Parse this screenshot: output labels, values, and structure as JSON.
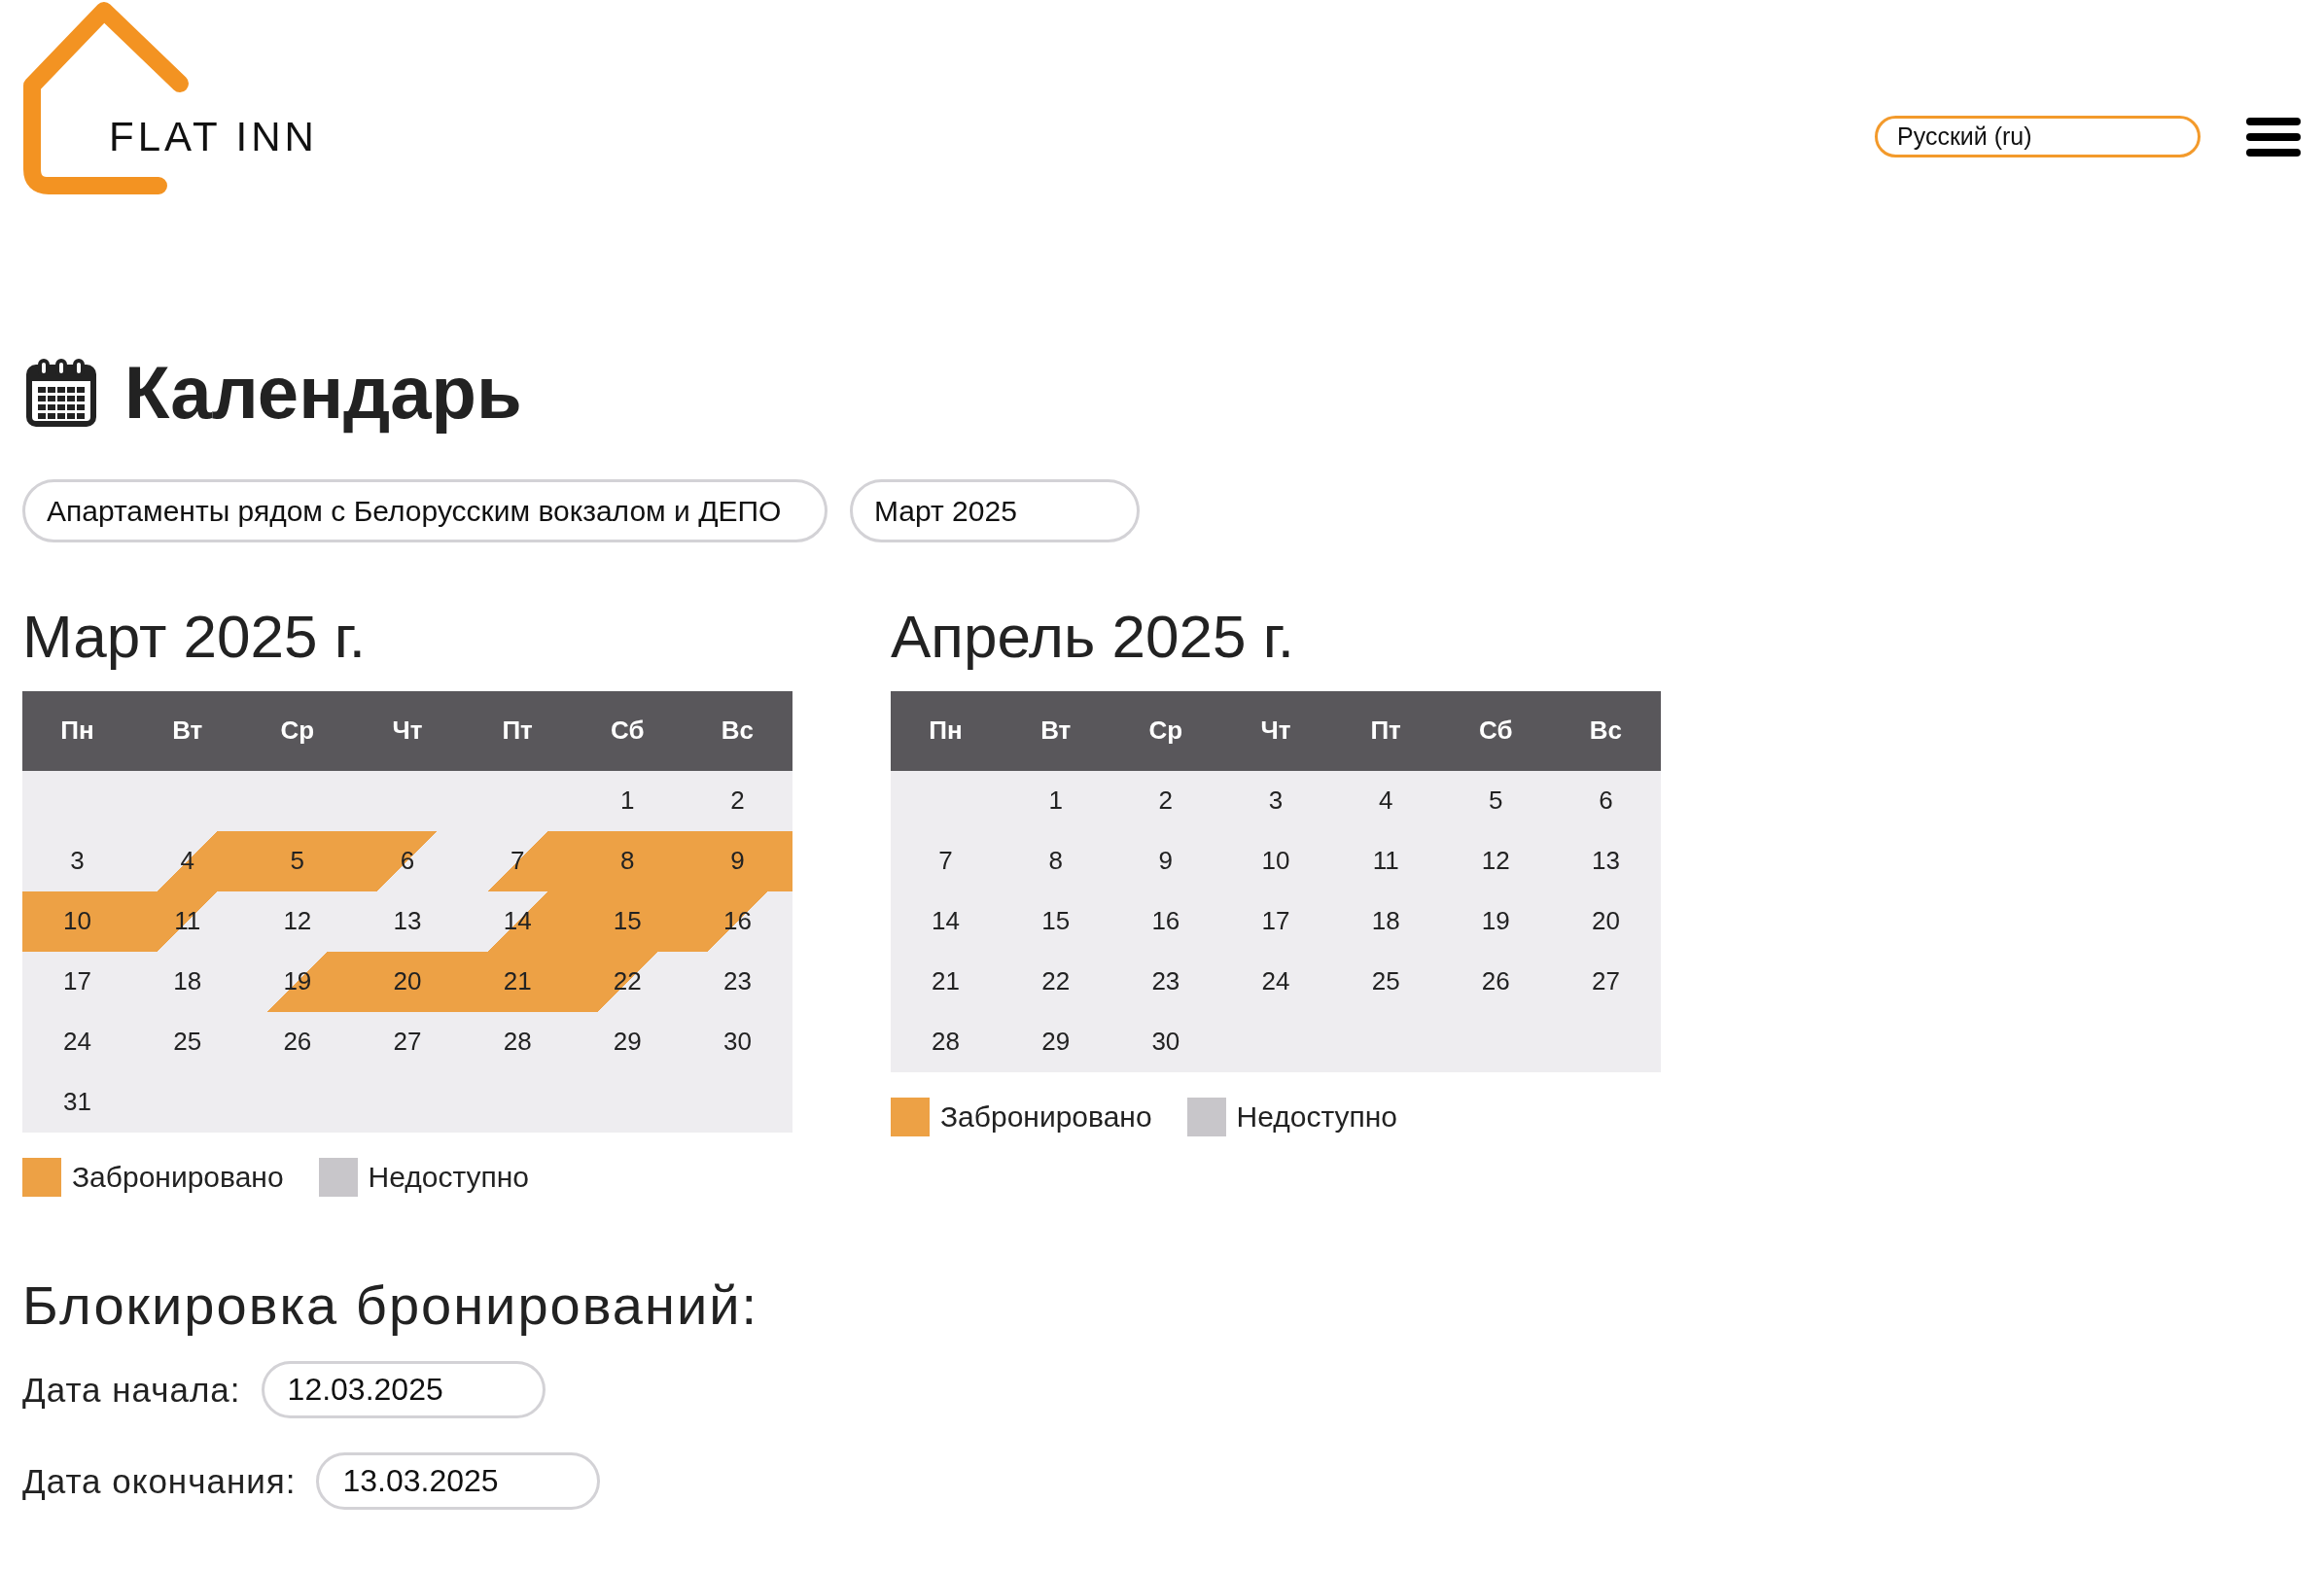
{
  "header": {
    "logo_text": "FLAT INN",
    "language": "Русский (ru)"
  },
  "page_title": "Календарь",
  "filters": [
    {
      "value": "Апартаменты рядом с Белорусским вокзалом и ДЕПО"
    },
    {
      "value": "Март 2025"
    }
  ],
  "months": [
    {
      "title": "Март 2025 г.",
      "weekdays": [
        "Пн",
        "Вт",
        "Ср",
        "Чт",
        "Пт",
        "Сб",
        "Вс"
      ],
      "weeks": [
        [
          {
            "day": "1",
            "kind": "free"
          },
          {
            "day": "2",
            "kind": "free"
          }
        ],
        [
          {
            "day": "3",
            "kind": "free"
          },
          {
            "day": "4",
            "kind": "checkin"
          },
          {
            "day": "5",
            "kind": "booked"
          },
          {
            "day": "6",
            "kind": "checkout"
          },
          {
            "day": "7",
            "kind": "checkin"
          },
          {
            "day": "8",
            "kind": "booked"
          },
          {
            "day": "9",
            "kind": "booked"
          }
        ],
        [
          {
            "day": "10",
            "kind": "booked"
          },
          {
            "day": "11",
            "kind": "checkout"
          },
          {
            "day": "12",
            "kind": "free"
          },
          {
            "day": "13",
            "kind": "free"
          },
          {
            "day": "14",
            "kind": "checkin"
          },
          {
            "day": "15",
            "kind": "booked"
          },
          {
            "day": "16",
            "kind": "checkout"
          }
        ],
        [
          {
            "day": "17",
            "kind": "free"
          },
          {
            "day": "18",
            "kind": "free"
          },
          {
            "day": "19",
            "kind": "checkin"
          },
          {
            "day": "20",
            "kind": "booked"
          },
          {
            "day": "21",
            "kind": "booked"
          },
          {
            "day": "22",
            "kind": "checkout"
          },
          {
            "day": "23",
            "kind": "free"
          }
        ],
        [
          {
            "day": "24",
            "kind": "free"
          },
          {
            "day": "25",
            "kind": "free"
          },
          {
            "day": "26",
            "kind": "free"
          },
          {
            "day": "27",
            "kind": "free"
          },
          {
            "day": "28",
            "kind": "free"
          },
          {
            "day": "29",
            "kind": "free"
          },
          {
            "day": "30",
            "kind": "free"
          }
        ],
        [
          {
            "day": "31",
            "kind": "free"
          }
        ]
      ],
      "legend": [
        {
          "label": "Забронировано",
          "color": "#eda145"
        },
        {
          "label": "Недоступно",
          "color": "#c8c6ca"
        }
      ]
    },
    {
      "title": "Апрель 2025 г.",
      "weekdays": [
        "Пн",
        "Вт",
        "Ср",
        "Чт",
        "Пт",
        "Сб",
        "Вс"
      ],
      "weeks": [
        [
          {
            "day": "1",
            "kind": "free"
          },
          {
            "day": "2",
            "kind": "free"
          },
          {
            "day": "3",
            "kind": "free"
          },
          {
            "day": "4",
            "kind": "free"
          },
          {
            "day": "5",
            "kind": "free"
          },
          {
            "day": "6",
            "kind": "free"
          }
        ],
        [
          {
            "day": "7",
            "kind": "free"
          },
          {
            "day": "8",
            "kind": "free"
          },
          {
            "day": "9",
            "kind": "free"
          },
          {
            "day": "10",
            "kind": "free"
          },
          {
            "day": "11",
            "kind": "free"
          },
          {
            "day": "12",
            "kind": "free"
          },
          {
            "day": "13",
            "kind": "free"
          }
        ],
        [
          {
            "day": "14",
            "kind": "free"
          },
          {
            "day": "15",
            "kind": "free"
          },
          {
            "day": "16",
            "kind": "free"
          },
          {
            "day": "17",
            "kind": "free"
          },
          {
            "day": "18",
            "kind": "free"
          },
          {
            "day": "19",
            "kind": "free"
          },
          {
            "day": "20",
            "kind": "free"
          }
        ],
        [
          {
            "day": "21",
            "kind": "free"
          },
          {
            "day": "22",
            "kind": "free"
          },
          {
            "day": "23",
            "kind": "free"
          },
          {
            "day": "24",
            "kind": "free"
          },
          {
            "day": "25",
            "kind": "free"
          },
          {
            "day": "26",
            "kind": "free"
          },
          {
            "day": "27",
            "kind": "free"
          }
        ],
        [
          {
            "day": "28",
            "kind": "free"
          },
          {
            "day": "29",
            "kind": "free"
          },
          {
            "day": "30",
            "kind": "free"
          }
        ]
      ],
      "legend": [
        {
          "label": "Забронировано",
          "color": "#eda145"
        },
        {
          "label": "Недоступно",
          "color": "#c8c6ca"
        }
      ]
    }
  ],
  "blocking": {
    "title": "Блокировка бронирований:",
    "fields": [
      {
        "label": "Дата начала:",
        "value": "12.03.2025"
      },
      {
        "label": "Дата окончания:",
        "value": "13.03.2025"
      }
    ]
  }
}
